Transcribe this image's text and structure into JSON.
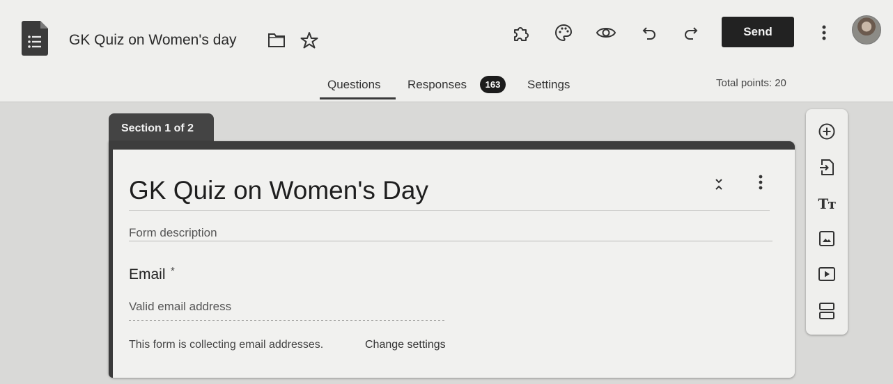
{
  "header": {
    "form_title": "GK Quiz on Women's day",
    "send_label": "Send",
    "tabs": [
      {
        "label": "Questions",
        "active": true
      },
      {
        "label": "Responses",
        "badge": "163"
      },
      {
        "label": "Settings"
      }
    ],
    "total_points": "Total points: 20",
    "tool_icons": [
      "addon-icon",
      "palette-icon",
      "preview-eye-icon",
      "undo-icon",
      "redo-icon"
    ]
  },
  "section": {
    "tab_label": "Section 1 of 2",
    "title": "GK Quiz on Women's Day",
    "description_placeholder": "Form description"
  },
  "email_question": {
    "label": "Email",
    "required_mark": "*",
    "placeholder": "Valid email address",
    "collecting_note": "This form is collecting email addresses.",
    "change_settings_link": "Change settings"
  },
  "side_toolbar": {
    "icons": [
      "add-question-icon",
      "import-questions-icon",
      "add-title-icon",
      "add-image-icon",
      "add-video-icon",
      "add-section-icon"
    ],
    "title_glyph": "Tт"
  },
  "colors": {
    "send_button": "#222222",
    "section_bar": "#3d3d3d",
    "background": "#d9d9d7"
  }
}
